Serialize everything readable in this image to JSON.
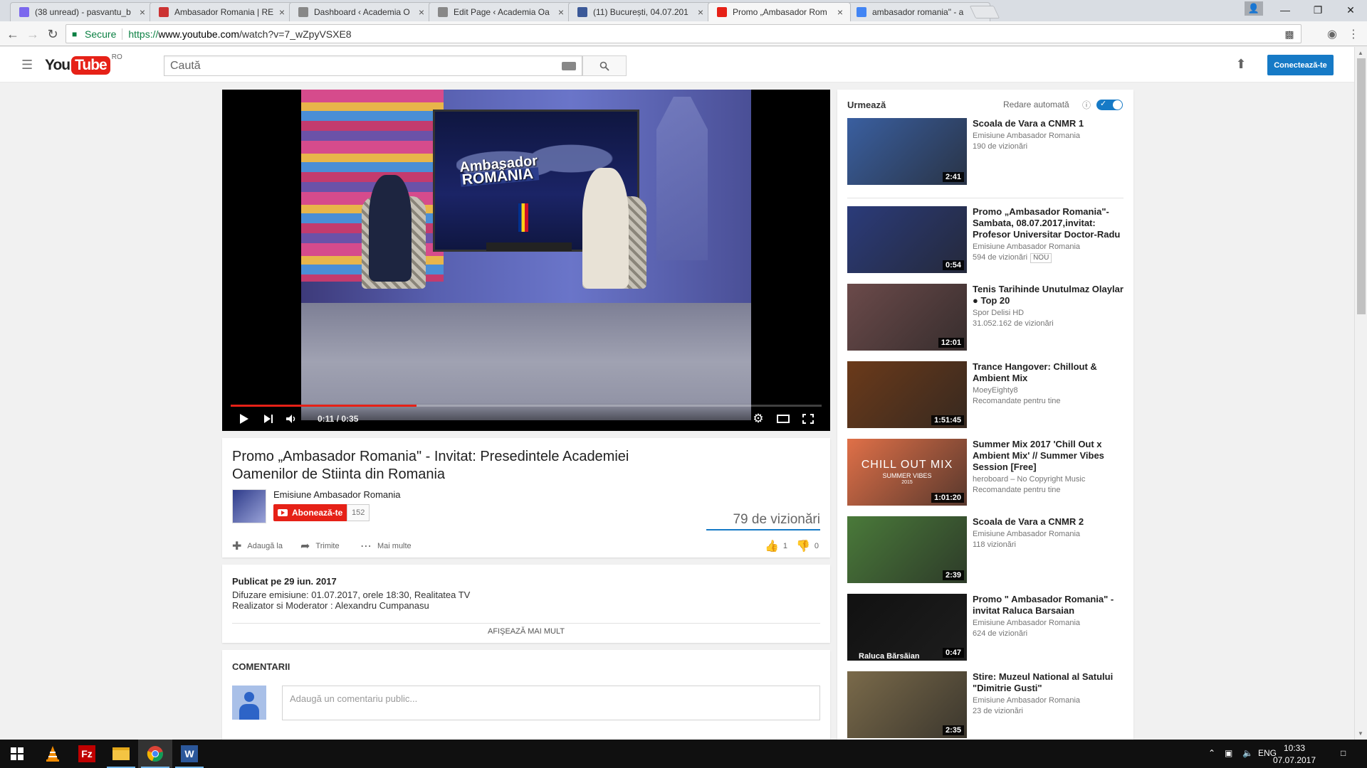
{
  "browser": {
    "tabs": [
      {
        "title": "(38 unread) - pasvantu_b",
        "favicon_color": "#7b68ee",
        "icon": "mail-icon"
      },
      {
        "title": "Ambasador Romania | RE",
        "favicon_color": "#c33",
        "icon": "bow-icon"
      },
      {
        "title": "Dashboard ‹ Academia O",
        "favicon_color": "#888",
        "icon": "page-icon"
      },
      {
        "title": "Edit Page ‹ Academia Oa",
        "favicon_color": "#888",
        "icon": "page-icon"
      },
      {
        "title": "(11) București, 04.07.201",
        "favicon_color": "#3b5998",
        "icon": "facebook-icon"
      },
      {
        "title": "Promo „Ambasador Rom",
        "favicon_color": "#e62117",
        "icon": "youtube-icon"
      },
      {
        "title": "ambasador romania\" - a",
        "favicon_color": "#4285f4",
        "icon": "google-icon"
      }
    ],
    "active_tab": 5,
    "secure_label": "Secure",
    "url_scheme": "https://",
    "url_host": "www.youtube.com",
    "url_path": "/watch?v=7_wZpyVSXE8"
  },
  "masthead": {
    "logo_you": "You",
    "logo_tube": "Tube",
    "country": "RO",
    "search_placeholder": "Caută",
    "signin_label": "Conectează-te"
  },
  "player": {
    "time_current": "0:11",
    "time_total": "0:35",
    "time_display": "0:11 / 0:35",
    "progress_fraction": 0.314,
    "buffer_fraction": 0.314,
    "progress_bar_color": "#e62117",
    "overlay_line1": "Ambasador",
    "overlay_line2": "ROMÂNIA"
  },
  "video": {
    "title": "Promo „Ambasador Romania\" - Invitat: Presedintele Academiei Oamenilor de Stiinta din Romania",
    "channel": "Emisiune Ambasador Romania",
    "subscribe_label": "Abonează-te",
    "subscriber_count": "152",
    "views": "79 de vizionări",
    "actions": {
      "add_to": "Adaugă la",
      "share": "Trimite",
      "more": "Mai multe"
    },
    "likes": "1",
    "dislikes": "0"
  },
  "description": {
    "published": "Publicat pe 29 iun. 2017",
    "line1": "Difuzare emisiune: 01.07.2017, orele 18:30, Realitatea TV",
    "line2": "Realizator si Moderator : Alexandru Cumpanasu",
    "show_more": "AFIŞEAZĂ MAI MULT"
  },
  "comments": {
    "title": "COMENTARII",
    "placeholder": "Adaugă un comentariu public..."
  },
  "sidebar": {
    "up_next": "Urmează",
    "autoplay": "Redare automată",
    "items": [
      {
        "title": "Scoala de Vara a CNMR 1",
        "channel": "Emisiune Ambasador Romania",
        "meta": "190 de vizionări",
        "badge": "",
        "duration": "2:41",
        "thumb_color": "#3a5fa0"
      },
      {
        "title": "Promo „Ambasador Romania\"- Sambata, 08.07.2017,invitat: Profesor Universitar Doctor-Radu",
        "channel": "Emisiune Ambasador Romania",
        "meta": "594 de vizionări",
        "badge": "NOU",
        "duration": "0:54",
        "thumb_color": "#2b3b7a"
      },
      {
        "title": "Tenis Tarihinde Unutulmaz Olaylar ● Top 20",
        "channel": "Spor Delisi HD",
        "meta": "31.052.162 de vizionări",
        "badge": "",
        "duration": "12:01",
        "thumb_color": "#6b4a4a"
      },
      {
        "title": "Trance Hangover: Chillout & Ambient Mix",
        "channel": "MoeyEighty8",
        "meta": "Recomandate pentru tine",
        "badge": "",
        "duration": "1:51:45",
        "thumb_color": "#6b3a1a"
      },
      {
        "title": "Summer Mix 2017 'Chill Out x Ambient Mix' // Summer Vibes Session [Free]",
        "channel": "heroboard – No Copyright Music",
        "meta": "Recomandate pentru tine",
        "badge": "",
        "duration": "1:01:20",
        "thumb_color": "#e07048",
        "thumb_text1": "CHILL OUT MIX",
        "thumb_text2": "SUMMER VIBES",
        "thumb_text3": "2015"
      },
      {
        "title": "Scoala de Vara a CNMR 2",
        "channel": "Emisiune Ambasador Romania",
        "meta": "118 vizionări",
        "badge": "",
        "duration": "2:39",
        "thumb_color": "#4a7a3a"
      },
      {
        "title": "Promo \" Ambasador Romania\" - invitat Raluca Barsaian",
        "channel": "Emisiune Ambasador Romania",
        "meta": "624 de vizionări",
        "badge": "",
        "duration": "0:47",
        "thumb_color": "#111111",
        "thumb_caption": "Raluca Bărsăian"
      },
      {
        "title": "Stire: Muzeul National al Satului \"Dimitrie Gusti\"",
        "channel": "Emisiune Ambasador Romania",
        "meta": "23 de vizionări",
        "badge": "",
        "duration": "2:35",
        "thumb_color": "#7a6a4a"
      }
    ]
  },
  "taskbar": {
    "lang": "ENG",
    "time": "10:33",
    "date": "07.07.2017"
  }
}
